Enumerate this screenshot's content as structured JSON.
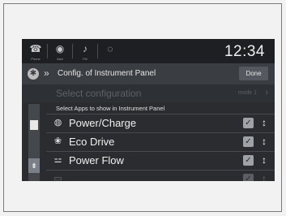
{
  "statusbar": {
    "icons": [
      {
        "name": "phone-icon",
        "glyph": "☎",
        "sub": "Phone"
      },
      {
        "name": "navi-icon",
        "glyph": "◉",
        "sub": "Navi"
      },
      {
        "name": "fm-icon",
        "glyph": "♪",
        "sub": "FM"
      },
      {
        "name": "settings-icon",
        "glyph": "◌",
        "sub": ""
      }
    ],
    "clock": "12:34"
  },
  "header": {
    "chevrons": "»",
    "title": "Config. of Instrument Panel",
    "done_label": "Done"
  },
  "select_config": {
    "label": "Select configuration",
    "value": "mode 1",
    "arrow": "›"
  },
  "list_title": "Select Apps to show in Instrument Panel",
  "scroll_down_glyph": "⇟",
  "rows": [
    {
      "icon_name": "power-charge-icon",
      "glyph": "◍",
      "label": "Power/Charge",
      "checked": true
    },
    {
      "icon_name": "eco-drive-icon",
      "glyph": "❀",
      "label": "Eco Drive",
      "checked": true
    },
    {
      "icon_name": "power-flow-icon",
      "glyph": "⚍",
      "label": "Power Flow",
      "checked": true
    },
    {
      "icon_name": "partial-app-icon",
      "glyph": "▭",
      "label": "",
      "checked": true
    }
  ],
  "check_glyph": "✓",
  "handle_glyph": "↕"
}
